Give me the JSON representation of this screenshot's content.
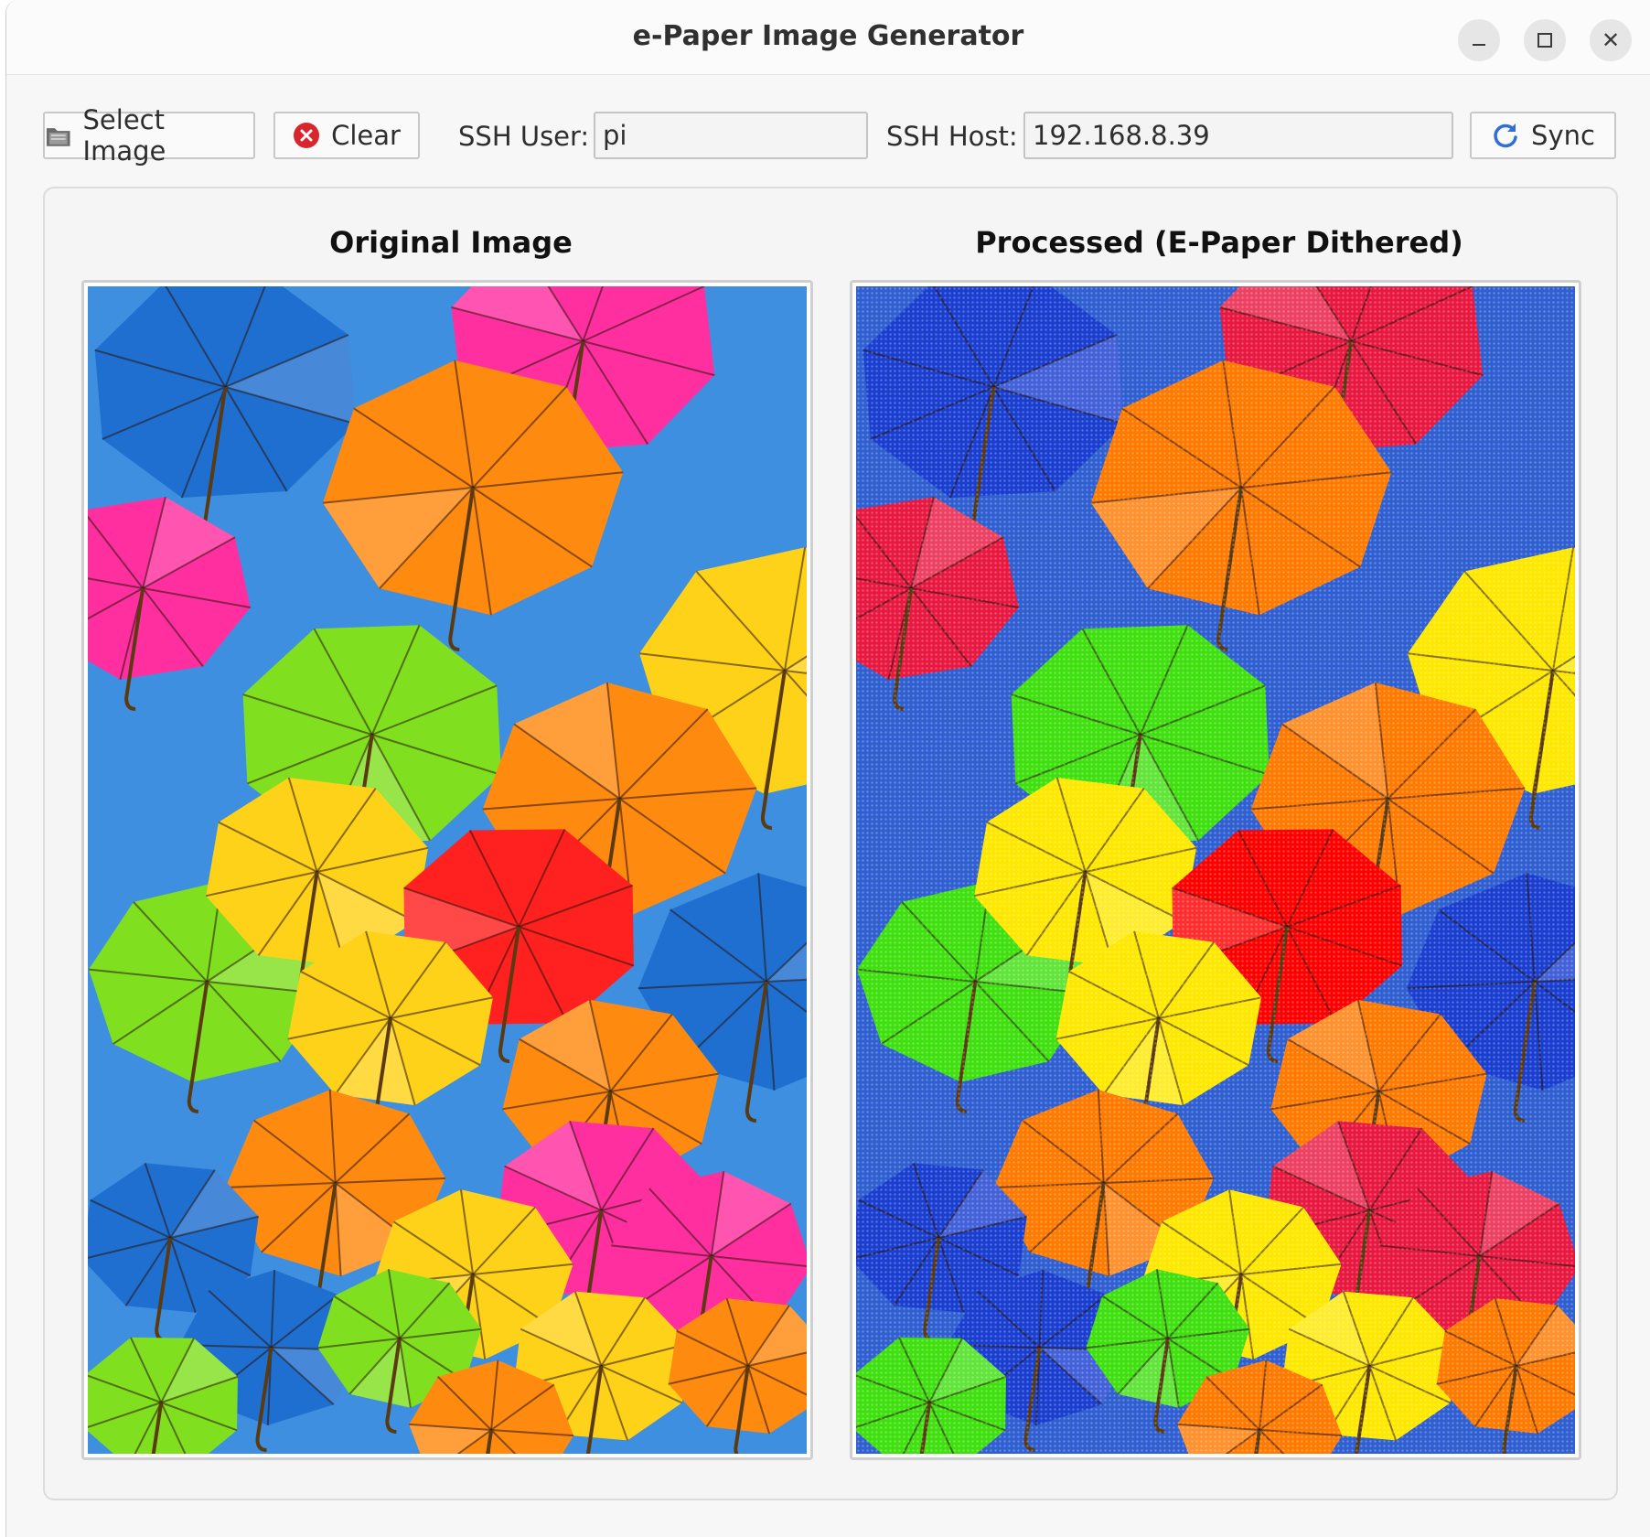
{
  "window": {
    "title": "e-Paper Image Generator"
  },
  "toolbar": {
    "select_label": "Select Image",
    "clear_label": "Clear",
    "ssh_user_label": "SSH User:",
    "ssh_user_value": "pi",
    "ssh_host_label": "SSH Host:",
    "ssh_host_value": "192.168.8.39",
    "sync_label": "Sync"
  },
  "panels": {
    "original_title": "Original Image",
    "processed_title": "Processed (E-Paper Dithered)"
  },
  "colors": {
    "sky": "#3f8fe0",
    "sky_processed": "#2f5fd0",
    "clear_icon": "#d9262e",
    "sync_icon": "#2f6fd6"
  },
  "icons": {
    "select": "folder-icon",
    "clear": "clear-icon",
    "sync": "refresh-icon"
  }
}
